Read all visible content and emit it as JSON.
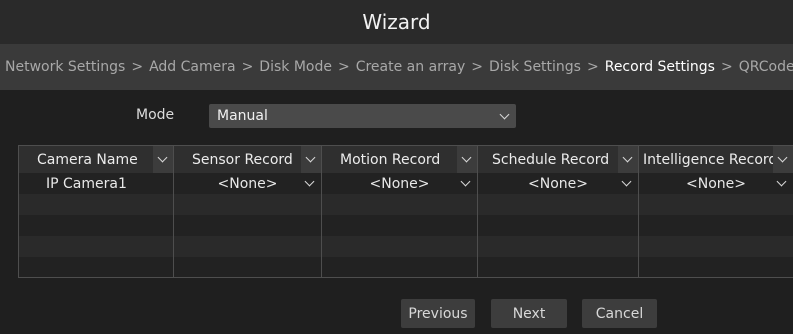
{
  "window": {
    "title": "Wizard"
  },
  "breadcrumb": {
    "items": [
      {
        "label": "Network Settings",
        "active": false
      },
      {
        "label": "Add Camera",
        "active": false
      },
      {
        "label": "Disk Mode",
        "active": false
      },
      {
        "label": "Create an array",
        "active": false
      },
      {
        "label": "Disk Settings",
        "active": false
      },
      {
        "label": "Record Settings",
        "active": true
      },
      {
        "label": "QRCode",
        "active": false
      }
    ],
    "separator": ">"
  },
  "mode": {
    "label": "Mode",
    "value": "Manual"
  },
  "table": {
    "columns": [
      "Camera Name",
      "Sensor Record",
      "Motion Record",
      "Schedule Record",
      "Intelligence Record"
    ],
    "rows": [
      [
        "IP Camera1",
        "<None>",
        "<None>",
        "<None>",
        "<None>"
      ]
    ]
  },
  "buttons": {
    "previous": "Previous",
    "next": "Next",
    "cancel": "Cancel"
  },
  "colors": {
    "background": "#1f1f1f",
    "breadcrumb_bar": "#3a3a3a",
    "active_text": "#ffffff",
    "inactive_text": "#a8a8a8"
  }
}
